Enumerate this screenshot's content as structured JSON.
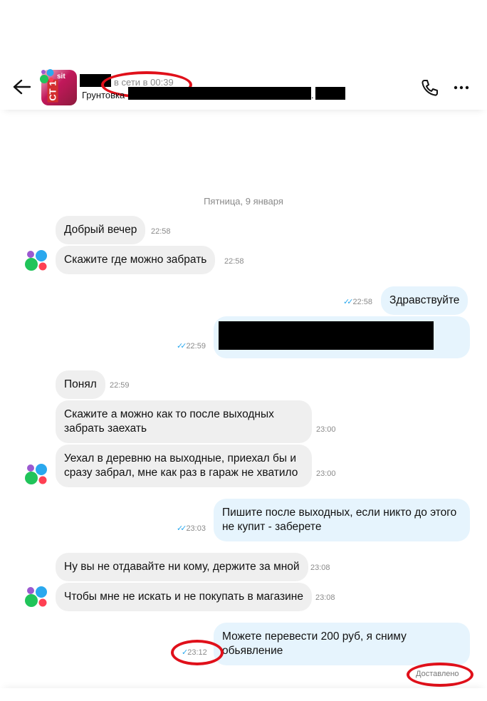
{
  "header": {
    "status": "в сети в 00:39",
    "subtitle": "Грунтовка",
    "sub_dot": ".",
    "thumb_label": "sit",
    "thumb_code": "CT 1"
  },
  "date_separator": "Пятница, 9 января",
  "messages": [
    {
      "text": "Добрый вечер",
      "time": "22:58"
    },
    {
      "text": "Скажите где можно  забрать",
      "time": "22:58"
    },
    {
      "text": "Здравствуйте",
      "time": "22:58"
    },
    {
      "text": "",
      "time": "22:59"
    },
    {
      "text": "Понял",
      "time": "22:59"
    },
    {
      "text": "Скажите а можно как то после выходных забрать заехать",
      "time": "23:00"
    },
    {
      "text": "Уехал в деревню на выходные, приехал бы и сразу забрал, мне как раз в гараж не хватило",
      "time": "23:00"
    },
    {
      "text": "Пишите после выходных, если никто до этого не купит - заберете",
      "time": "23:03"
    },
    {
      "text": "Ну вы не отдавайте ни кому, держите за мной",
      "time": "23:08"
    },
    {
      "text": "Чтобы мне не искать и не покупать в магазине",
      "time": "23:08"
    },
    {
      "text": "Можете перевести 200 руб, я сниму обьявление",
      "time": "23:12"
    }
  ],
  "delivery_status": "Доставлено",
  "colors": {
    "incoming_bubble": "#efefef",
    "outgoing_bubble": "#e6f4fd",
    "read_check": "#2aa8ee",
    "annotation_red": "#e0101a"
  },
  "icons": [
    "back-arrow-icon",
    "phone-icon",
    "more-icon",
    "check-icon",
    "double-check-icon",
    "avito-dots-icon"
  ]
}
